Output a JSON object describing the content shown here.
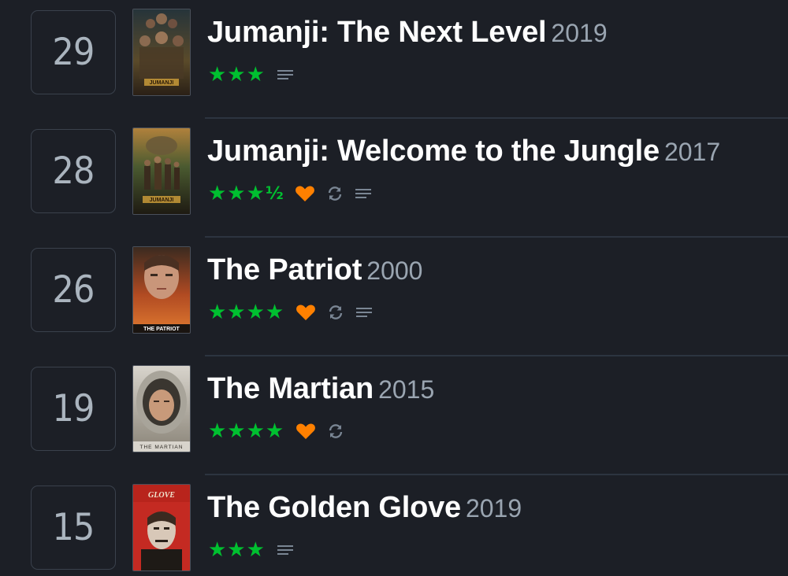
{
  "diary": {
    "entries": [
      {
        "day": "29",
        "title": "Jumanji: The Next Level",
        "year": "2019",
        "rating_stars": "★★★",
        "rating_half": "",
        "liked": false,
        "rewatch": false,
        "review": true,
        "poster_text": "JUMANJI"
      },
      {
        "day": "28",
        "title": "Jumanji: Welcome to the Jungle",
        "year": "2017",
        "rating_stars": "★★★",
        "rating_half": "½",
        "liked": true,
        "rewatch": true,
        "review": true,
        "poster_text": "JUMANJI"
      },
      {
        "day": "26",
        "title": "The Patriot",
        "year": "2000",
        "rating_stars": "★★★★",
        "rating_half": "",
        "liked": true,
        "rewatch": true,
        "review": true,
        "poster_text": "THE PATRIOT"
      },
      {
        "day": "19",
        "title": "The Martian",
        "year": "2015",
        "rating_stars": "★★★★",
        "rating_half": "",
        "liked": true,
        "rewatch": true,
        "review": false,
        "poster_text": "THE MARTIAN"
      },
      {
        "day": "15",
        "title": "The Golden Glove",
        "year": "2019",
        "rating_stars": "★★★",
        "rating_half": "",
        "liked": false,
        "rewatch": false,
        "review": true,
        "poster_text": "GLOVE"
      }
    ]
  },
  "colors": {
    "background": "#1c1f26",
    "star": "#00c030",
    "like": "#ff8000",
    "muted": "#9aa5b1",
    "divider": "#2c3440"
  }
}
